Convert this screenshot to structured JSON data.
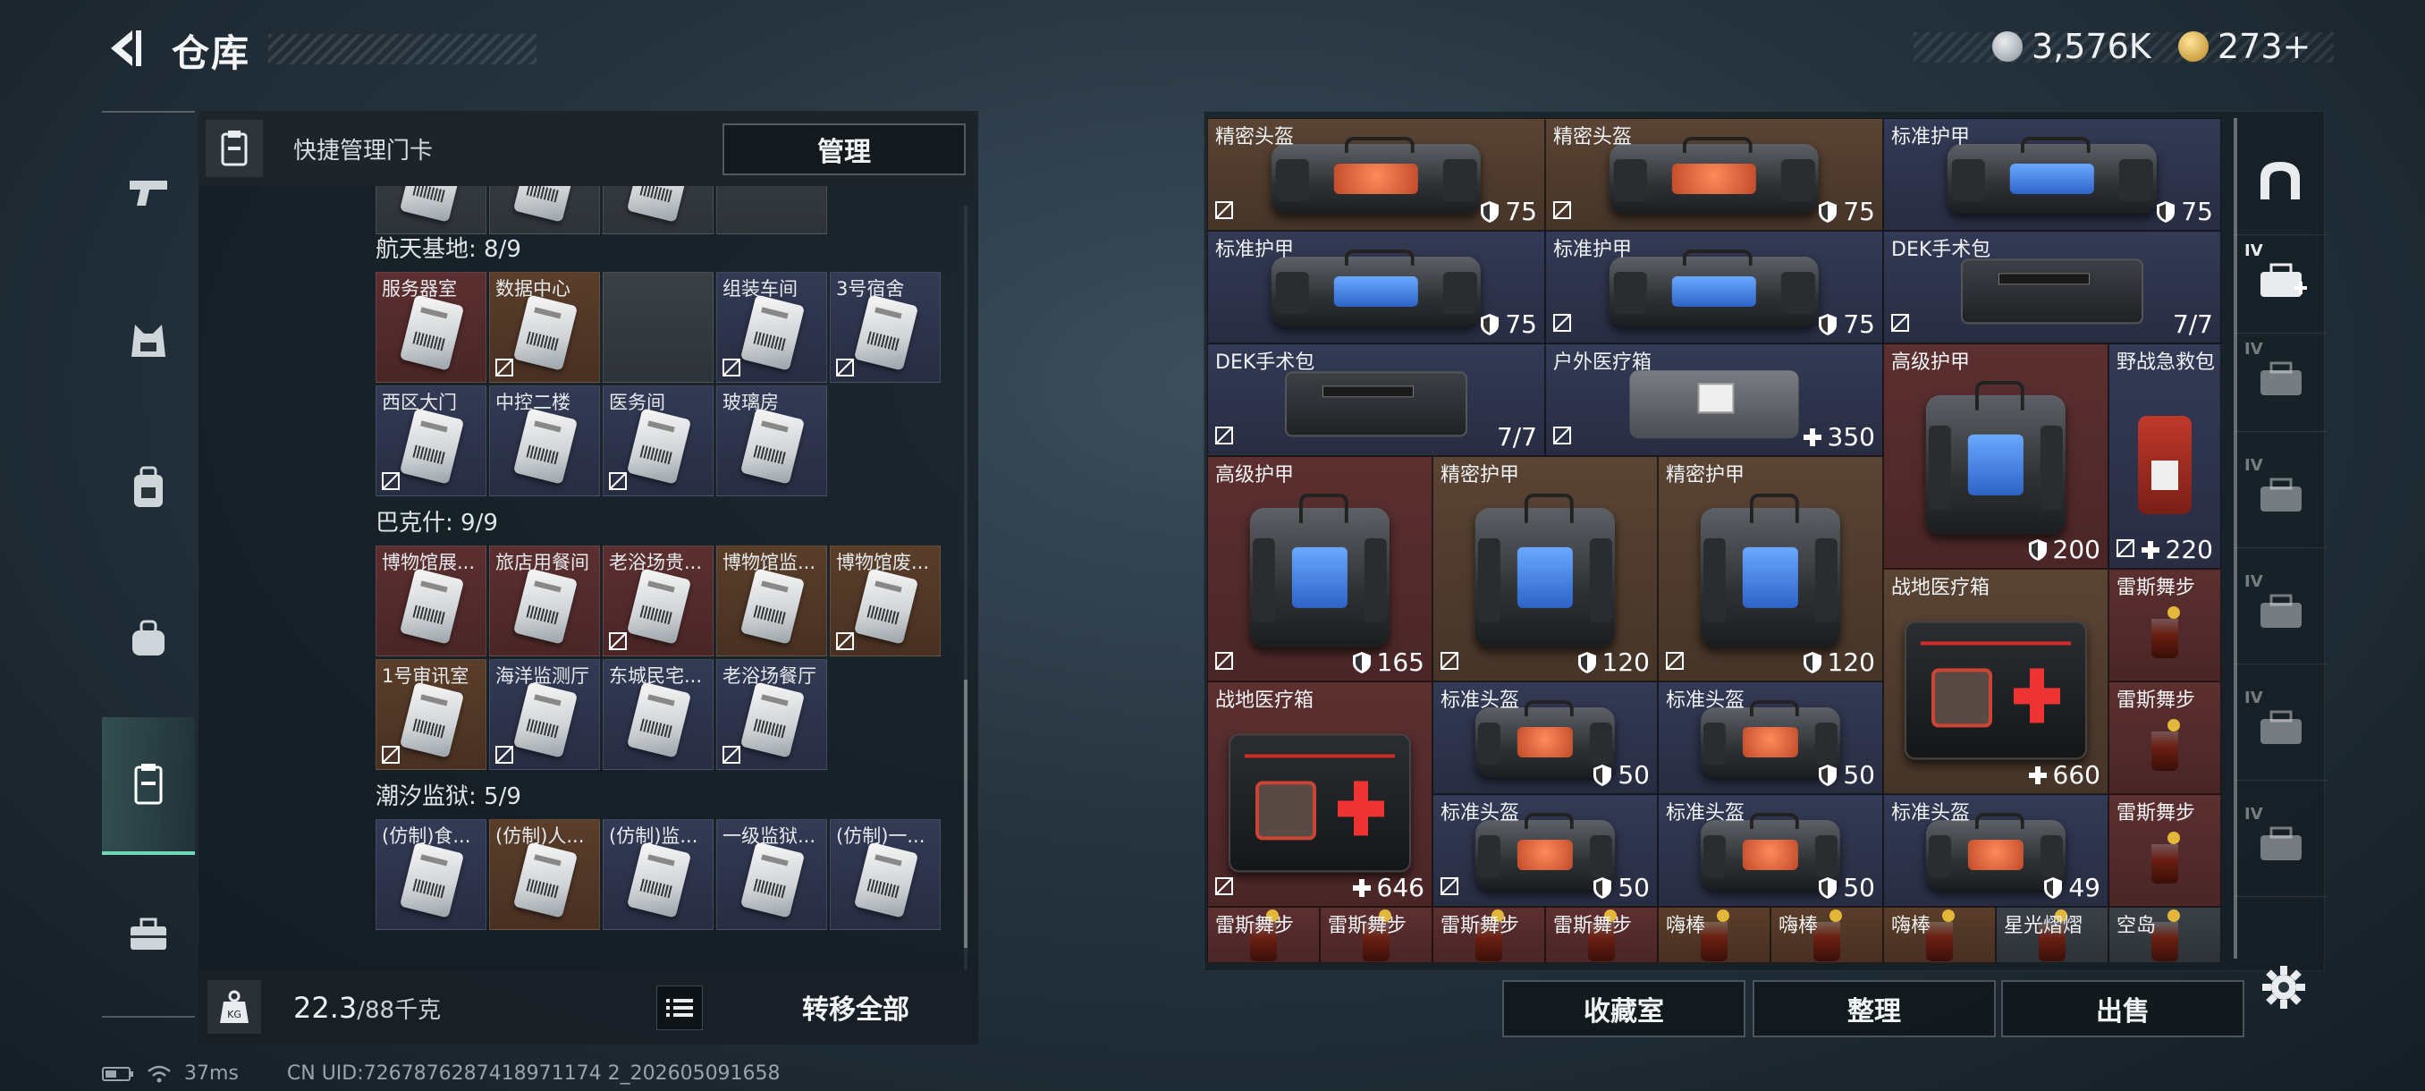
{
  "header": {
    "title": "仓库"
  },
  "currency": [
    {
      "icon": "silver-coin-icon",
      "value": "3,576K"
    },
    {
      "icon": "gold-triangle-icon",
      "value": "273+"
    }
  ],
  "left_nav": [
    {
      "icon": "pistol-icon"
    },
    {
      "icon": "vest-icon"
    },
    {
      "icon": "backpack-icon"
    },
    {
      "icon": "bag-icon"
    },
    {
      "icon": "keycard-case-icon",
      "active": true
    },
    {
      "icon": "toolbox-icon"
    }
  ],
  "quick_manage": {
    "label": "快捷管理门卡",
    "button": "管理"
  },
  "sections": [
    {
      "title": "航天基地: 8/9",
      "cards": [
        "服务器室",
        "数据中心",
        "",
        "组装车间",
        "3号宿舍",
        "西区大门",
        "中控二楼",
        "医务间",
        "玻璃房"
      ]
    },
    {
      "title": "巴克什: 9/9",
      "cards": [
        "博物馆展...",
        "旅店用餐间",
        "老浴场贵...",
        "博物馆监...",
        "博物馆废...",
        "1号审讯室",
        "海洋监测厅",
        "东城民宅...",
        "老浴场餐厅"
      ]
    },
    {
      "title": "潮汐监狱: 5/9",
      "cards": [
        "(仿制)食...",
        "(仿制)人...",
        "(仿制)监...",
        "一级监狱...",
        "(仿制)一..."
      ]
    }
  ],
  "weight": {
    "current": "22.3",
    "max": "/88千克"
  },
  "transfer_button": "转移全部",
  "status": {
    "ping": "37ms",
    "uid": "CN UID:7267876287418971174 2_202605091658"
  },
  "grid_items": [
    {
      "name": "精密头盔",
      "value": "75",
      "vicon": "shield",
      "art": "helmet"
    },
    {
      "name": "精密头盔",
      "value": "75",
      "vicon": "shield",
      "art": "helmet"
    },
    {
      "name": "标准护甲",
      "value": "75",
      "vicon": "shield",
      "art": "armor"
    },
    {
      "name": "标准护甲",
      "value": "75",
      "vicon": "shield",
      "art": "armor"
    },
    {
      "name": "标准护甲",
      "value": "75",
      "vicon": "shield",
      "art": "armor"
    },
    {
      "name": "DEK手术包",
      "value": "7/7",
      "vicon": "",
      "art": "pouch"
    },
    {
      "name": "DEK手术包",
      "value": "7/7",
      "vicon": "",
      "art": "pouch"
    },
    {
      "name": "户外医疗箱",
      "value": "350",
      "vicon": "plus",
      "art": "outdoor"
    },
    {
      "name": "高级护甲",
      "value": "200",
      "vicon": "shield",
      "art": "armor"
    },
    {
      "name": "野战急救包",
      "value": "220",
      "vicon": "plus",
      "art": "redkit"
    },
    {
      "name": "高级护甲",
      "value": "165",
      "vicon": "shield",
      "art": "armor"
    },
    {
      "name": "精密护甲",
      "value": "120",
      "vicon": "shield",
      "art": "armor"
    },
    {
      "name": "精密护甲",
      "value": "120",
      "vicon": "shield",
      "art": "armor"
    },
    {
      "name": "战地医疗箱",
      "value": "660",
      "vicon": "plus",
      "art": "medkit"
    },
    {
      "name": "雷斯舞步",
      "value": "",
      "vicon": "",
      "art": "drink"
    },
    {
      "name": "雷斯舞步",
      "value": "",
      "vicon": "",
      "art": "drink"
    },
    {
      "name": "战地医疗箱",
      "value": "646",
      "vicon": "plus",
      "art": "medkit"
    },
    {
      "name": "标准头盔",
      "value": "50",
      "vicon": "shield",
      "art": "helmet"
    },
    {
      "name": "标准头盔",
      "value": "50",
      "vicon": "shield",
      "art": "helmet"
    },
    {
      "name": "标准头盔",
      "value": "50",
      "vicon": "shield",
      "art": "helmet"
    },
    {
      "name": "标准头盔",
      "value": "50",
      "vicon": "shield",
      "art": "helmet"
    },
    {
      "name": "标准头盔",
      "value": "49",
      "vicon": "shield",
      "art": "helmet"
    },
    {
      "name": "雷斯舞步",
      "value": "",
      "vicon": "",
      "art": "drink"
    },
    {
      "name": "雷斯舞步",
      "value": "",
      "vicon": "",
      "art": "drink"
    },
    {
      "name": "雷斯舞步",
      "value": "",
      "vicon": "",
      "art": "drink"
    },
    {
      "name": "雷斯舞步",
      "value": "",
      "vicon": "",
      "art": "drink"
    },
    {
      "name": "雷斯舞步",
      "value": "",
      "vicon": "",
      "art": "drink"
    },
    {
      "name": "嗨棒",
      "value": "",
      "vicon": "",
      "art": "drink"
    },
    {
      "name": "嗨棒",
      "value": "",
      "vicon": "",
      "art": "drink"
    },
    {
      "name": "嗨棒",
      "value": "",
      "vicon": "",
      "art": "drink"
    },
    {
      "name": "星光熠熠",
      "value": "",
      "vicon": "",
      "art": "drink"
    },
    {
      "name": "空岛",
      "value": "",
      "vicon": "",
      "art": "drink"
    }
  ],
  "right_nav": [
    {
      "icon": "helmet-slot-icon"
    },
    {
      "icon": "add-case-iv-icon",
      "label": "IV"
    },
    {
      "icon": "case-iv-icon-1",
      "label": "IV"
    },
    {
      "icon": "case-iv-icon-2",
      "label": "IV"
    },
    {
      "icon": "case-iv-icon-3",
      "label": "IV"
    },
    {
      "icon": "case-iv-icon-4",
      "label": "IV"
    },
    {
      "icon": "case-iv-icon-5",
      "label": "IV"
    }
  ],
  "bottom_buttons": [
    "收藏室",
    "整理",
    "出售"
  ]
}
